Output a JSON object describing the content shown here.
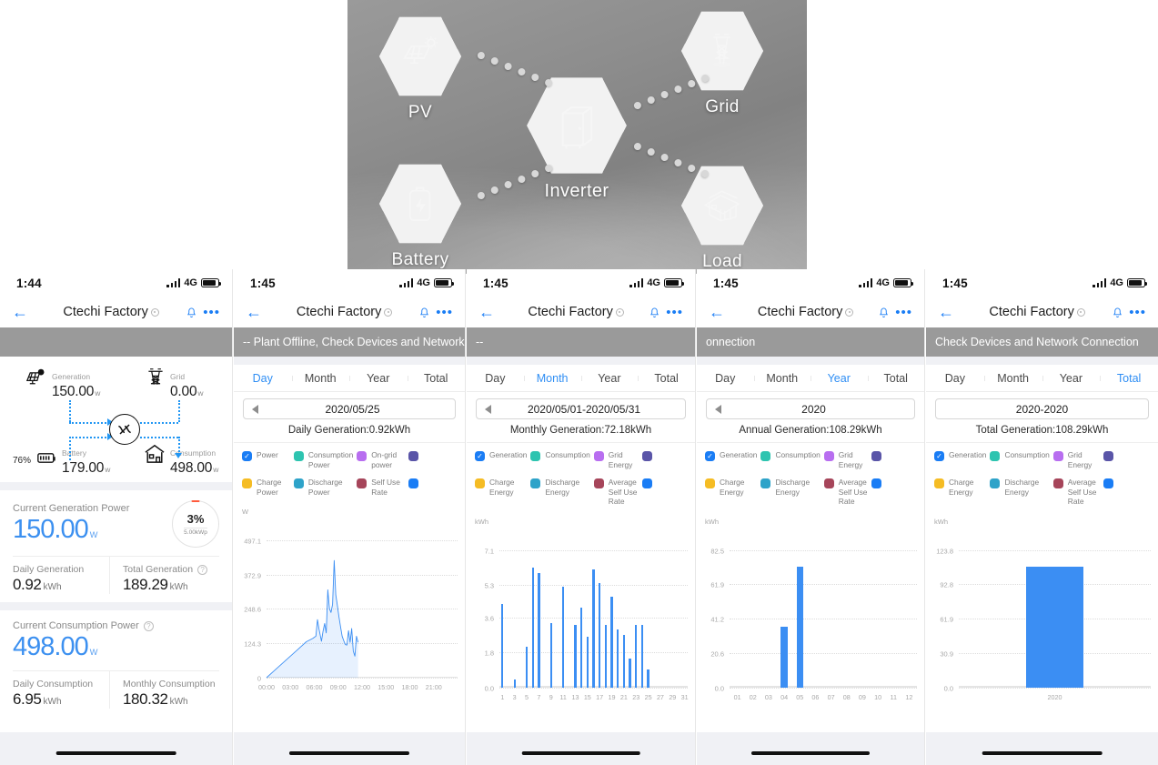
{
  "hero": {
    "nodes": [
      {
        "id": "pv",
        "label": "PV",
        "icon": "solar-panel-icon"
      },
      {
        "id": "battery",
        "label": "Battery",
        "icon": "battery-icon"
      },
      {
        "id": "inverter",
        "label": "Inverter",
        "icon": "inverter-icon"
      },
      {
        "id": "grid",
        "label": "Grid",
        "icon": "power-tower-icon"
      },
      {
        "id": "load",
        "label": "Load",
        "icon": "house-icon"
      }
    ]
  },
  "panel1": {
    "status": {
      "time": "1:44",
      "network": "4G"
    },
    "nav": {
      "back": "←",
      "title": "Ctechi Factory",
      "bell": "bell-icon",
      "more": "•••"
    },
    "banner": "",
    "flow": {
      "generation": {
        "label": "Generation",
        "value": "150.00",
        "unit": "w"
      },
      "grid": {
        "label": "Grid",
        "value": "0.00",
        "unit": "w"
      },
      "battery": {
        "label": "Battery",
        "value": "179.00",
        "unit": "w",
        "percent": "76%"
      },
      "consumption": {
        "label": "Consumption",
        "value": "498.00",
        "unit": "w"
      }
    },
    "generation_card": {
      "title": "Current Generation Power",
      "value": "150.00",
      "unit": "w",
      "donut_percent": "3%",
      "donut_sub": "5.00kWp",
      "daily_label": "Daily Generation",
      "daily_value": "0.92",
      "daily_unit": "kWh",
      "total_label": "Total Generation",
      "total_value": "189.29",
      "total_unit": "kWh"
    },
    "consumption_card": {
      "title": "Current Consumption Power",
      "value": "498.00",
      "unit": "w",
      "daily_label": "Daily Consumption",
      "daily_value": "6.95",
      "daily_unit": "kWh",
      "monthly_label": "Monthly Consumption",
      "monthly_value": "180.32",
      "monthly_unit": "kWh"
    }
  },
  "panel2": {
    "status": {
      "time": "1:45",
      "network": "4G"
    },
    "nav": {
      "title": "Ctechi Factory"
    },
    "banner": "--                                        Plant Offline, Check Devices and Network Connection",
    "tabs": [
      {
        "label": "Day",
        "active": true
      },
      {
        "label": "Month",
        "active": false
      },
      {
        "label": "Year",
        "active": false
      },
      {
        "label": "Total",
        "active": false
      }
    ],
    "date": "2020/05/25",
    "summary": "Daily Generation:0.92kWh",
    "legend": [
      {
        "label": "Power",
        "color": "#1a7df5",
        "checked": true
      },
      {
        "label": "Consumption Power",
        "color": "#2ec4b0",
        "checked": false
      },
      {
        "label": "On-grid power",
        "color": "#b86ef0",
        "checked": false
      },
      {
        "label": "",
        "color": "#5a55a8",
        "checked": false
      },
      {
        "label": "Charge Power",
        "color": "#f5bc24",
        "checked": false
      },
      {
        "label": "Discharge Power",
        "color": "#2ea3c9",
        "checked": false
      },
      {
        "label": "Self Use Rate",
        "color": "#a6455a",
        "checked": false
      },
      {
        "label": "",
        "color": "#1a7df5",
        "checked": false
      }
    ]
  },
  "panel3": {
    "status": {
      "time": "1:45",
      "network": "4G"
    },
    "nav": {
      "title": "Ctechi Factory"
    },
    "banner": "--",
    "tabs": [
      {
        "label": "Day",
        "active": false
      },
      {
        "label": "Month",
        "active": true
      },
      {
        "label": "Year",
        "active": false
      },
      {
        "label": "Total",
        "active": false
      }
    ],
    "date": "2020/05/01-2020/05/31",
    "summary": "Monthly Generation:72.18kWh",
    "legend": [
      {
        "label": "Generation",
        "color": "#1a7df5",
        "checked": true
      },
      {
        "label": "Consumption",
        "color": "#2ec4b0",
        "checked": false
      },
      {
        "label": "Grid Energy",
        "color": "#b86ef0",
        "checked": false
      },
      {
        "label": "",
        "color": "#5a55a8",
        "checked": false
      },
      {
        "label": "Charge Energy",
        "color": "#f5bc24",
        "checked": false
      },
      {
        "label": "Discharge Energy",
        "color": "#2ea3c9",
        "checked": false
      },
      {
        "label": "Average Self Use Rate",
        "color": "#a6455a",
        "checked": false
      },
      {
        "label": "",
        "color": "#1a7df5",
        "checked": false
      }
    ]
  },
  "panel4": {
    "status": {
      "time": "1:45",
      "network": "4G"
    },
    "nav": {
      "title": "Ctechi Factory"
    },
    "banner": "onnection",
    "tabs": [
      {
        "label": "Day",
        "active": false
      },
      {
        "label": "Month",
        "active": false
      },
      {
        "label": "Year",
        "active": true
      },
      {
        "label": "Total",
        "active": false
      }
    ],
    "date": "2020",
    "summary": "Annual Generation:108.29kWh",
    "legend": [
      {
        "label": "Generation",
        "color": "#1a7df5",
        "checked": true
      },
      {
        "label": "Consumption",
        "color": "#2ec4b0",
        "checked": false
      },
      {
        "label": "Grid Energy",
        "color": "#b86ef0",
        "checked": false
      },
      {
        "label": "",
        "color": "#5a55a8",
        "checked": false
      },
      {
        "label": "Charge Energy",
        "color": "#f5bc24",
        "checked": false
      },
      {
        "label": "Discharge Energy",
        "color": "#2ea3c9",
        "checked": false
      },
      {
        "label": "Average Self Use Rate",
        "color": "#a6455a",
        "checked": false
      },
      {
        "label": "",
        "color": "#1a7df5",
        "checked": false
      }
    ]
  },
  "panel5": {
    "status": {
      "time": "1:45",
      "network": "4G"
    },
    "nav": {
      "title": "Ctechi Factory"
    },
    "banner": "Check Devices and Network Connection",
    "tabs": [
      {
        "label": "Day",
        "active": false
      },
      {
        "label": "Month",
        "active": false
      },
      {
        "label": "Year",
        "active": false
      },
      {
        "label": "Total",
        "active": true
      }
    ],
    "date": "2020-2020",
    "summary": "Total Generation:108.29kWh",
    "legend": [
      {
        "label": "Generation",
        "color": "#1a7df5",
        "checked": true
      },
      {
        "label": "Consumption",
        "color": "#2ec4b0",
        "checked": false
      },
      {
        "label": "Grid Energy",
        "color": "#b86ef0",
        "checked": false
      },
      {
        "label": "",
        "color": "#5a55a8",
        "checked": false
      },
      {
        "label": "Charge Energy",
        "color": "#f5bc24",
        "checked": false
      },
      {
        "label": "Discharge Energy",
        "color": "#2ea3c9",
        "checked": false
      },
      {
        "label": "Average Self Use Rate",
        "color": "#a6455a",
        "checked": false
      },
      {
        "label": "",
        "color": "#1a7df5",
        "checked": false
      }
    ]
  },
  "chart_data": [
    {
      "id": "day-power",
      "type": "line",
      "title": "Daily Generation:0.92kWh",
      "xlabel": "",
      "ylabel": "W",
      "yticks": [
        0,
        124.3,
        248.6,
        372.9,
        497.1
      ],
      "ylim": [
        0,
        497.1
      ],
      "xticks": [
        "00:00",
        "03:00",
        "06:00",
        "09:00",
        "12:00",
        "15:00",
        "18:00",
        "21:00"
      ],
      "grid": true,
      "legend_position": "top",
      "series": [
        {
          "name": "Power",
          "color": "#3b8ef3",
          "x": [
            0.0,
            1.0,
            2.0,
            3.0,
            4.0,
            5.0,
            5.8,
            6.2,
            6.4,
            6.6,
            6.9,
            7.1,
            7.3,
            7.5,
            7.7,
            7.9,
            8.1,
            8.3,
            8.5,
            8.7,
            8.9,
            9.1,
            9.3,
            9.5,
            9.7,
            9.9,
            10.1,
            10.3,
            10.5,
            10.7,
            10.9,
            11.1,
            11.3,
            11.5,
            24.0
          ],
          "values": [
            0,
            26,
            52,
            78,
            104,
            130,
            142,
            150,
            210,
            175,
            132,
            168,
            196,
            162,
            318,
            250,
            236,
            266,
            424,
            300,
            262,
            220,
            184,
            150,
            134,
            120,
            118,
            170,
            128,
            178,
            96,
            78,
            150,
            128,
            null
          ]
        }
      ]
    },
    {
      "id": "month-generation",
      "type": "bar",
      "title": "Monthly Generation:72.18kWh",
      "xlabel": "",
      "ylabel": "kWh",
      "yticks": [
        0.0,
        1.8,
        3.6,
        5.3,
        7.1
      ],
      "ylim": [
        0,
        7.1
      ],
      "xticks": [
        "1",
        "3",
        "5",
        "7",
        "9",
        "11",
        "13",
        "15",
        "17",
        "19",
        "21",
        "23",
        "25",
        "27",
        "29",
        "31"
      ],
      "grid": true,
      "categories": [
        "1",
        "2",
        "3",
        "4",
        "5",
        "6",
        "7",
        "8",
        "9",
        "10",
        "11",
        "12",
        "13",
        "14",
        "15",
        "16",
        "17",
        "18",
        "19",
        "20",
        "21",
        "22",
        "23",
        "24",
        "25",
        "26",
        "27",
        "28",
        "29",
        "30",
        "31"
      ],
      "values": [
        4.3,
        0.0,
        0.4,
        0.0,
        2.1,
        6.2,
        5.9,
        0.0,
        3.3,
        0.0,
        5.2,
        0.0,
        3.2,
        4.1,
        2.6,
        6.1,
        5.4,
        3.2,
        4.7,
        3.0,
        2.7,
        1.5,
        3.2,
        3.2,
        0.9,
        0.0,
        0.0,
        0.0,
        0.0,
        0.0,
        0.0
      ],
      "series": [
        {
          "name": "Generation",
          "color": "#3b8ef3"
        }
      ]
    },
    {
      "id": "year-generation",
      "type": "bar",
      "title": "Annual Generation:108.29kWh",
      "xlabel": "",
      "ylabel": "kWh",
      "yticks": [
        0.0,
        20.6,
        41.2,
        61.9,
        82.5
      ],
      "ylim": [
        0,
        82.5
      ],
      "xticks": [
        "01",
        "02",
        "03",
        "04",
        "05",
        "06",
        "07",
        "08",
        "09",
        "10",
        "11",
        "12"
      ],
      "grid": true,
      "categories": [
        "01",
        "02",
        "03",
        "04",
        "05",
        "06",
        "07",
        "08",
        "09",
        "10",
        "11",
        "12"
      ],
      "values": [
        0,
        0,
        0,
        36.1,
        72.2,
        0,
        0,
        0,
        0,
        0,
        0,
        0
      ],
      "series": [
        {
          "name": "Generation",
          "color": "#3b8ef3"
        }
      ]
    },
    {
      "id": "total-generation",
      "type": "bar",
      "title": "Total Generation:108.29kWh",
      "xlabel": "",
      "ylabel": "kWh",
      "yticks": [
        0.0,
        30.9,
        61.9,
        92.8,
        123.8
      ],
      "ylim": [
        0,
        123.8
      ],
      "xticks": [
        "2020"
      ],
      "grid": true,
      "categories": [
        "2020"
      ],
      "values": [
        108.29
      ],
      "series": [
        {
          "name": "Generation",
          "color": "#3b8ef3"
        }
      ]
    }
  ]
}
